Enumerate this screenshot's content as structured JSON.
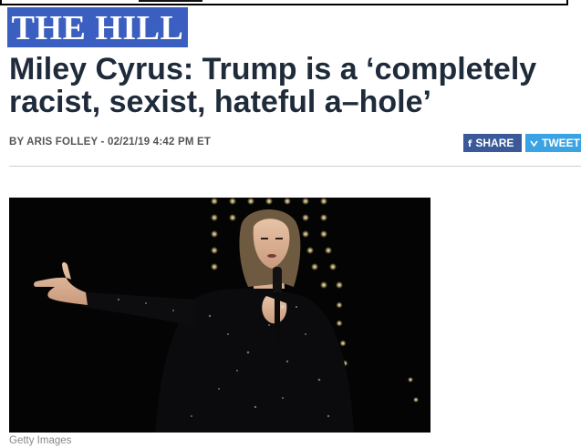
{
  "site": {
    "logo_text": "THE HILL"
  },
  "article": {
    "headline_line1": "Miley Cyrus: Trump is a ‘completely",
    "headline_line2": "racist, sexist, hateful a–hole’",
    "byline": "BY ARIS FOLLEY - 02/21/19 4:42 PM ET",
    "image_caption": "Getty Images"
  },
  "social": {
    "share_icon": "f",
    "share_label": "SHARE",
    "tweet_icon": "↓",
    "tweet_label": "TWEET"
  },
  "colors": {
    "logo_bg": "#3b5fc0",
    "headline": "#1f2b3a",
    "facebook": "#3b5998",
    "twitter": "#3aa3e3"
  },
  "icons": {
    "facebook": "facebook-icon",
    "twitter": "twitter-icon"
  }
}
